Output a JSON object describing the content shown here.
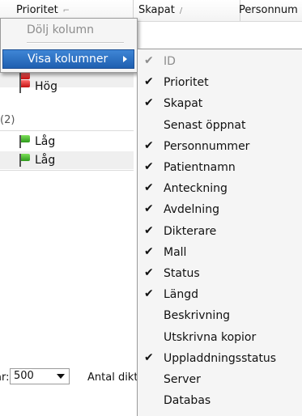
{
  "header": {
    "col_prioritet": "Prioritet",
    "col_skapat": "Skapat",
    "col_personnummer": "Personnum"
  },
  "rows": [
    {
      "label": "Hög",
      "flag": "red-flag-icon"
    },
    {
      "label": "Låg",
      "flag": "green-flag-icon"
    },
    {
      "label": "Låg",
      "flag": "green-flag-icon"
    }
  ],
  "group": {
    "count_label": "(2)"
  },
  "bottom": {
    "label_fragment": "ar:",
    "page_size": "500",
    "antal_fragment": "Antal dikt"
  },
  "context_menu": {
    "hide_column": "Dölj kolumn",
    "show_columns": "Visa kolumner"
  },
  "columns_submenu": [
    {
      "label": "ID",
      "checked": true,
      "disabled": true
    },
    {
      "label": "Prioritet",
      "checked": true,
      "disabled": false
    },
    {
      "label": "Skapat",
      "checked": true,
      "disabled": false
    },
    {
      "label": "Senast öppnat",
      "checked": false,
      "disabled": false
    },
    {
      "label": "Personnummer",
      "checked": true,
      "disabled": false
    },
    {
      "label": "Patientnamn",
      "checked": true,
      "disabled": false
    },
    {
      "label": "Anteckning",
      "checked": true,
      "disabled": false
    },
    {
      "label": "Avdelning",
      "checked": true,
      "disabled": false
    },
    {
      "label": "Dikterare",
      "checked": true,
      "disabled": false
    },
    {
      "label": "Mall",
      "checked": true,
      "disabled": false
    },
    {
      "label": "Status",
      "checked": true,
      "disabled": false
    },
    {
      "label": "Längd",
      "checked": true,
      "disabled": false
    },
    {
      "label": "Beskrivning",
      "checked": false,
      "disabled": false
    },
    {
      "label": "Utskrivna kopior",
      "checked": false,
      "disabled": false
    },
    {
      "label": "Uppladdningsstatus",
      "checked": true,
      "disabled": false
    },
    {
      "label": "Server",
      "checked": false,
      "disabled": false
    },
    {
      "label": "Databas",
      "checked": false,
      "disabled": false
    }
  ]
}
